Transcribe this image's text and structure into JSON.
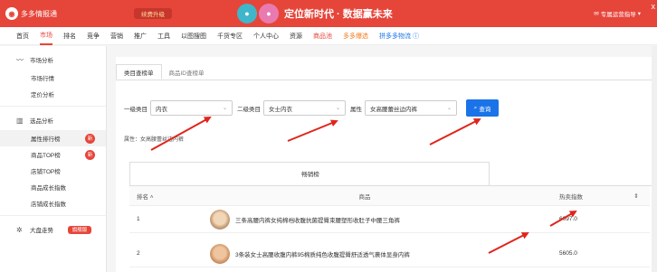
{
  "header": {
    "logo_text": "多多情报通",
    "upgrade_label": "续费升级",
    "slogan": "定位新时代 · 数据赢未来",
    "operator_label": "专属运营指导",
    "close_label": "x"
  },
  "nav": {
    "items": [
      {
        "label": "首页"
      },
      {
        "label": "市场"
      },
      {
        "label": "排名"
      },
      {
        "label": "竞争"
      },
      {
        "label": "营销"
      },
      {
        "label": "推广"
      },
      {
        "label": "工具"
      },
      {
        "label": "以图搜图"
      },
      {
        "label": "千货专区"
      },
      {
        "label": "个人中心"
      },
      {
        "label": "资源"
      },
      {
        "label": "商品池"
      },
      {
        "label": "多多爆选"
      },
      {
        "label": "拼多多物流 ⓘ"
      }
    ]
  },
  "sidebar": {
    "group1": {
      "label": "市场分析",
      "icon": "chart-line-icon"
    },
    "group1_items": [
      {
        "label": "市场行情"
      },
      {
        "label": "定价分析"
      }
    ],
    "group2": {
      "label": "选品分析",
      "icon": "bar-chart-icon"
    },
    "group2_items": [
      {
        "label": "属性排行榜",
        "badge": "新"
      },
      {
        "label": "商品TOP榜",
        "badge": "新"
      },
      {
        "label": "店铺TOP榜"
      },
      {
        "label": "商品成长指数"
      },
      {
        "label": "店铺成长指数"
      }
    ],
    "group3": {
      "label": "大盘走势",
      "icon": "trend-icon",
      "badge": "旗舰版"
    }
  },
  "main": {
    "tabs": [
      {
        "label": "类目查榜单"
      },
      {
        "label": "商品ID查榜单"
      }
    ],
    "filter": {
      "cat1_label": "一级类目",
      "cat1_value": "内衣",
      "cat2_label": "二级类目",
      "cat2_value": "女士内衣",
      "attr_label": "属性",
      "attr_value": "女高腰蕾丝边内裤",
      "query_label": "查询"
    },
    "attr_line": "属性：女高腰蕾丝边内裤",
    "subtab": "畅销榜",
    "table": {
      "col_rank": "排名 ˄",
      "col_goods": "商品",
      "col_index": "热卖指数",
      "col_sort": "⇕",
      "rows": [
        {
          "rank": "1",
          "name": "三条高腰内裤女纯棉裆收腹抗菌提臀束腰塑形收肚子中腰三角裤",
          "index": "6097.0"
        },
        {
          "rank": "2",
          "name": "3条装女士高腰收腹内裤95棉质纯色收腹提臀舒适透气裹体显身内裤",
          "index": "5605.0"
        }
      ]
    }
  },
  "colors": {
    "brand": "#e6453a",
    "accent": "#1a73e8"
  }
}
